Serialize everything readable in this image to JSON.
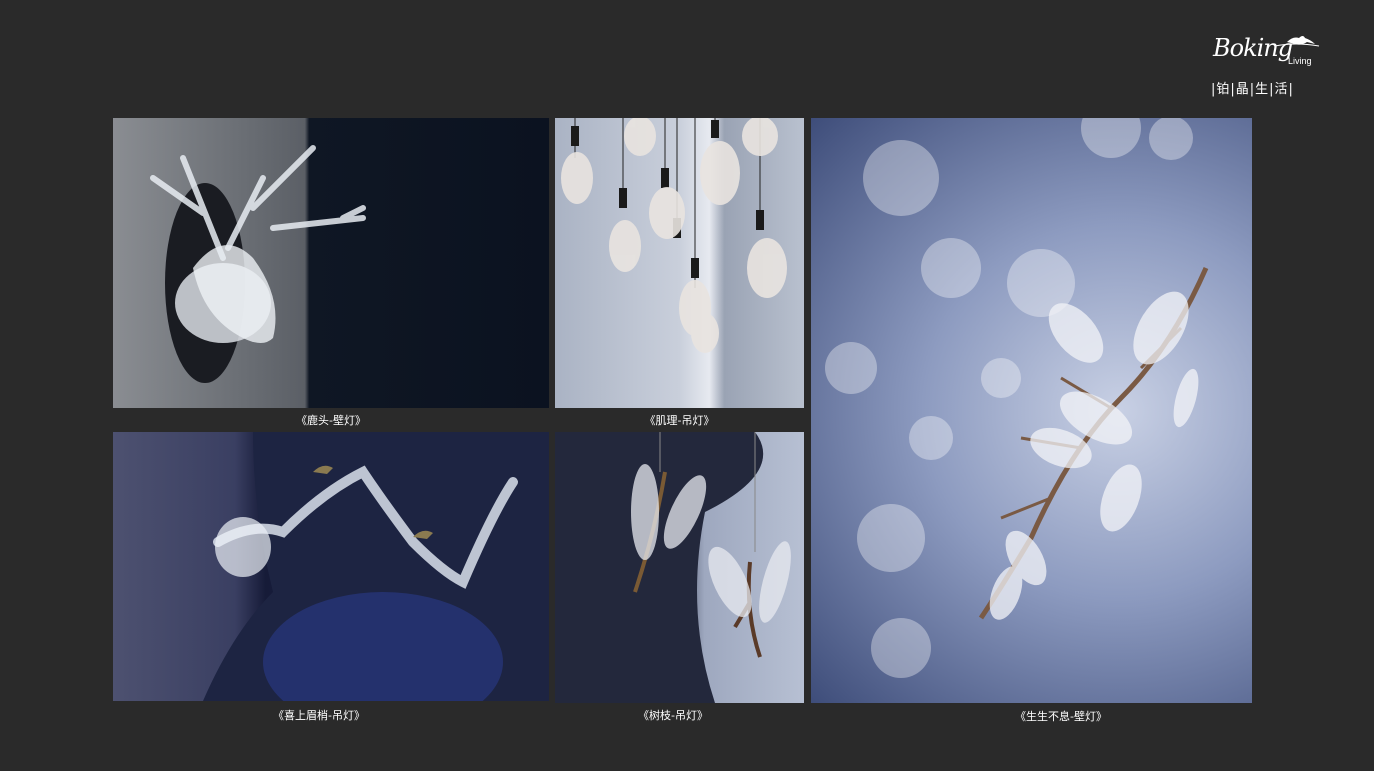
{
  "brand": {
    "script": "Boking",
    "sub": "Living",
    "cn": "|铂|晶|生|活|"
  },
  "captions": {
    "deer": "《鹿头-壁灯》",
    "texture": "《肌理-吊灯》",
    "branch_wall": "《生生不息-壁灯》",
    "magpie": "《喜上眉梢-吊灯》",
    "twig": "《树枝-吊灯》"
  }
}
